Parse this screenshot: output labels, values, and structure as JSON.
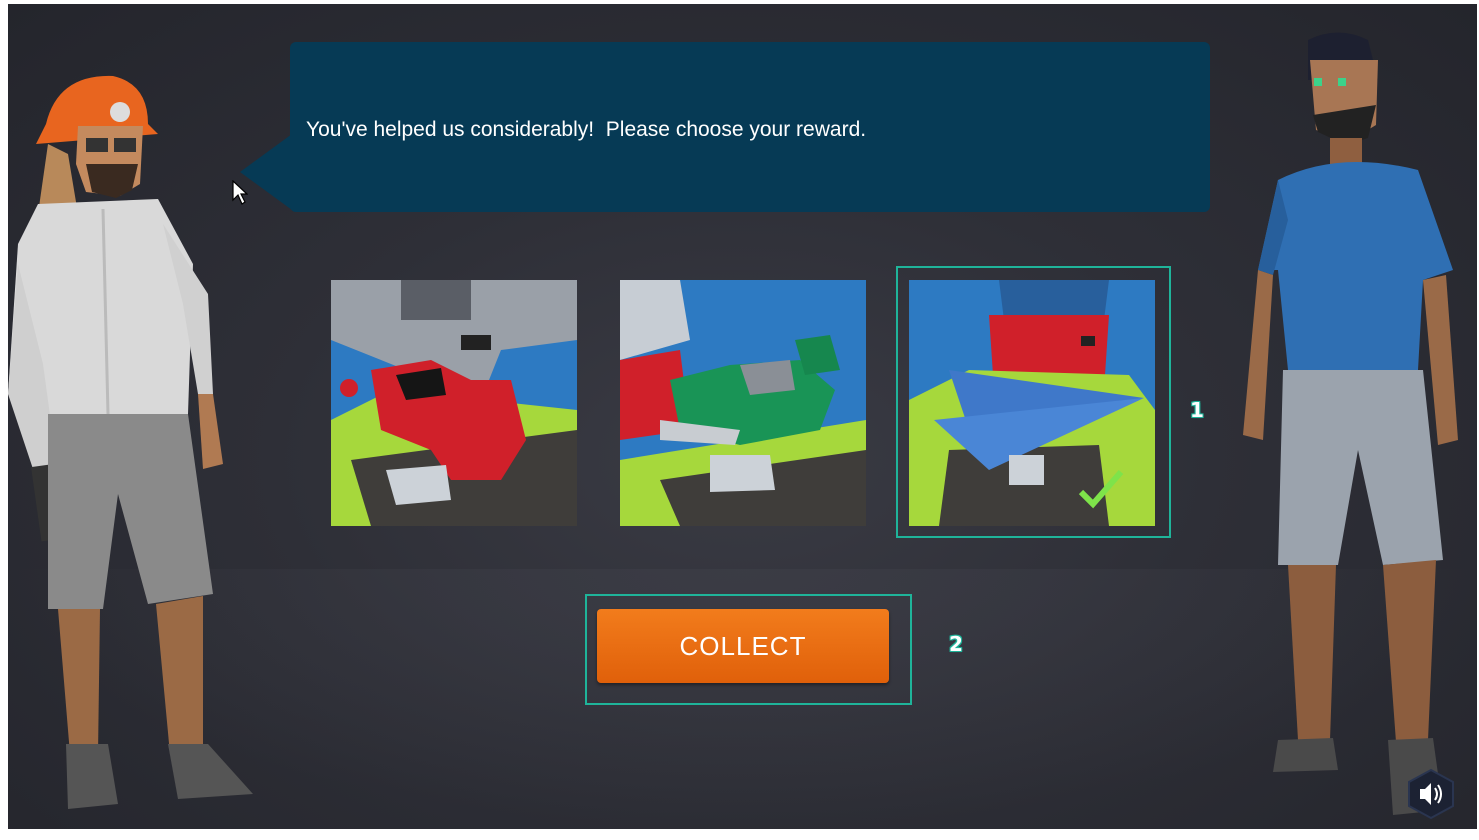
{
  "dialog": {
    "text": "You've helped us considerably!  Please choose your reward."
  },
  "rewards": [
    {
      "item": "scooter",
      "selected": false
    },
    {
      "item": "motorcycle",
      "selected": false
    },
    {
      "item": "paper-airplane",
      "selected": true
    }
  ],
  "collect_button": {
    "label": "COLLECT"
  },
  "step_markers": {
    "one": "1",
    "two": "2"
  },
  "colors": {
    "bubble": "#063a55",
    "accent": "#1fb49a",
    "button": "#ef7316",
    "check": "#7ee34a"
  }
}
